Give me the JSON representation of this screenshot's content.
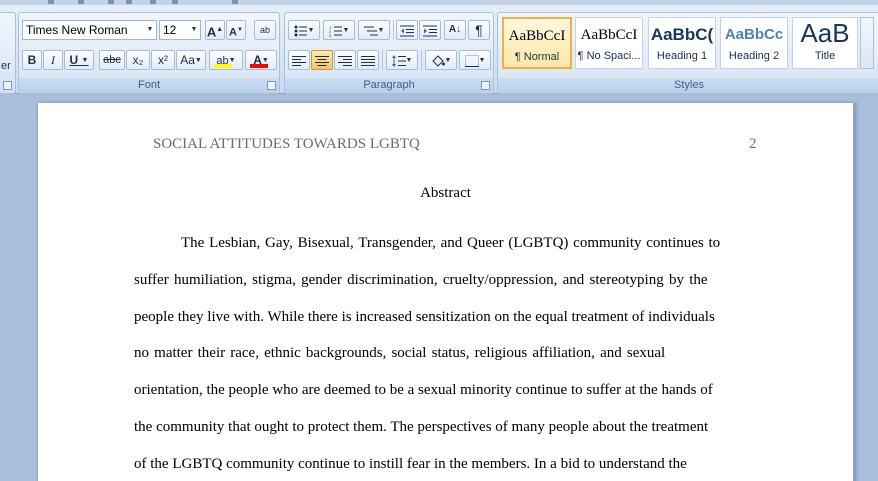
{
  "ribbon": {
    "font": {
      "label": "Font",
      "font_name": "Times New Roman",
      "font_size": "12",
      "grow_font": "A",
      "shrink_font": "A",
      "clear_format": "ab",
      "bold": "B",
      "italic": "I",
      "underline": "U",
      "strikethrough": "abc",
      "subscript": "x₂",
      "superscript": "x²",
      "change_case": "Aa",
      "highlight": "ab",
      "font_color": "A"
    },
    "paragraph": {
      "label": "Paragraph",
      "sort": "A↓",
      "show_marks": "¶"
    },
    "styles": {
      "label": "Styles",
      "items": [
        {
          "sample": "AaBbCcI",
          "name": "¶ Normal",
          "selected": true
        },
        {
          "sample": "AaBbCcI",
          "name": "¶ No Spaci...",
          "selected": false
        },
        {
          "sample": "AaBbC(",
          "name": "Heading 1",
          "selected": false
        },
        {
          "sample": "AaBbCc",
          "name": "Heading 2",
          "selected": false
        },
        {
          "sample": "AaB",
          "name": "Title",
          "selected": false
        }
      ]
    },
    "left_fragment": "er"
  },
  "colors": {
    "highlight_bar": "#ffff00",
    "font_color_bar": "#ff0000",
    "heading_blue": "#17365d",
    "selected_style_border": "#f0b040"
  },
  "document": {
    "header_title": "SOCIAL ATTITUDES TOWARDS LGBTQ",
    "page_number": "2",
    "heading": "Abstract",
    "lines": [
      "The Lesbian, Gay, Bisexual, Transgender, and Queer (LGBTQ) community continues to",
      "suffer humiliation, stigma, gender discrimination, cruelty/oppression, and stereotyping by the",
      "people they live with. While there is increased sensitization on the equal treatment of individuals",
      "no matter their race, ethnic backgrounds, social status, religious affiliation, and sexual",
      "orientation, the people who are deemed to be a sexual minority continue to suffer at the hands of",
      "the community that ought to protect them. The perspectives of many people about the treatment",
      "of the LGBTQ community continue to instill fear in the members.  In a bid to understand the"
    ]
  }
}
